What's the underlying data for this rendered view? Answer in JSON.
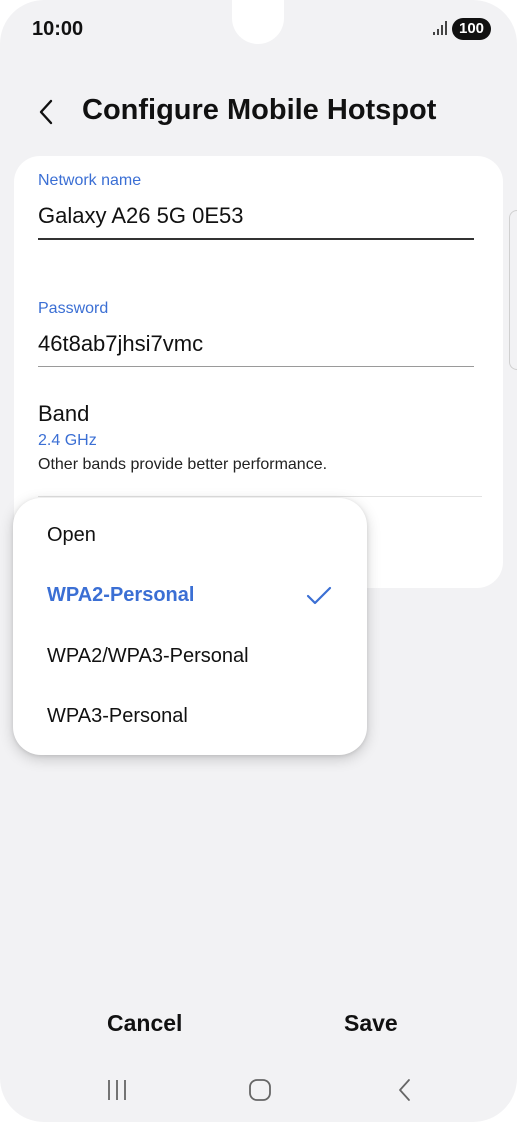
{
  "status_bar": {
    "time": "10:00",
    "battery": "100",
    "icons": [
      "signal-icon",
      "battery-icon"
    ]
  },
  "header": {
    "title": "Configure Mobile Hotspot",
    "back_icon": "back-arrow-icon"
  },
  "network_name": {
    "label": "Network name",
    "value": "Galaxy A26 5G 0E53"
  },
  "password": {
    "label": "Password",
    "value": "46t8ab7jhsi7vmc"
  },
  "band": {
    "title": "Band",
    "value": "2.4 GHz",
    "description": "Other bands provide better performance."
  },
  "security_dropdown": {
    "options": [
      {
        "label": "Open",
        "selected": false
      },
      {
        "label": "WPA2-Personal",
        "selected": true
      },
      {
        "label": "WPA2/WPA3-Personal",
        "selected": false
      },
      {
        "label": "WPA3-Personal",
        "selected": false
      }
    ]
  },
  "footer": {
    "cancel_label": "Cancel",
    "save_label": "Save"
  },
  "nav_bar": {
    "icons": [
      "recent-apps-icon",
      "home-icon",
      "back-icon"
    ]
  },
  "colors": {
    "accent": "#3b6fd4",
    "background": "#f2f2f4",
    "card": "#ffffff"
  }
}
